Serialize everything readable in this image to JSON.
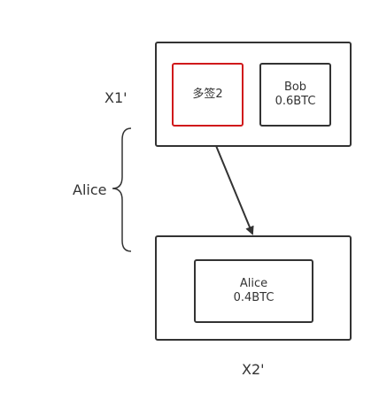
{
  "diagram": {
    "tx1": {
      "label": "X1'",
      "outputs": [
        {
          "line1": "多签2",
          "line2": "",
          "highlight_color": "#d0191b"
        },
        {
          "line1": "Bob",
          "line2": "0.6BTC",
          "highlight_color": "#333333"
        }
      ]
    },
    "tx2": {
      "label": "X2'",
      "outputs": [
        {
          "line1": "Alice",
          "line2": "0.4BTC",
          "highlight_color": "#333333"
        }
      ]
    },
    "brace_label": "Alice",
    "colors": {
      "stroke": "#333333",
      "highlight": "#d0191b",
      "background": "#ffffff"
    }
  }
}
